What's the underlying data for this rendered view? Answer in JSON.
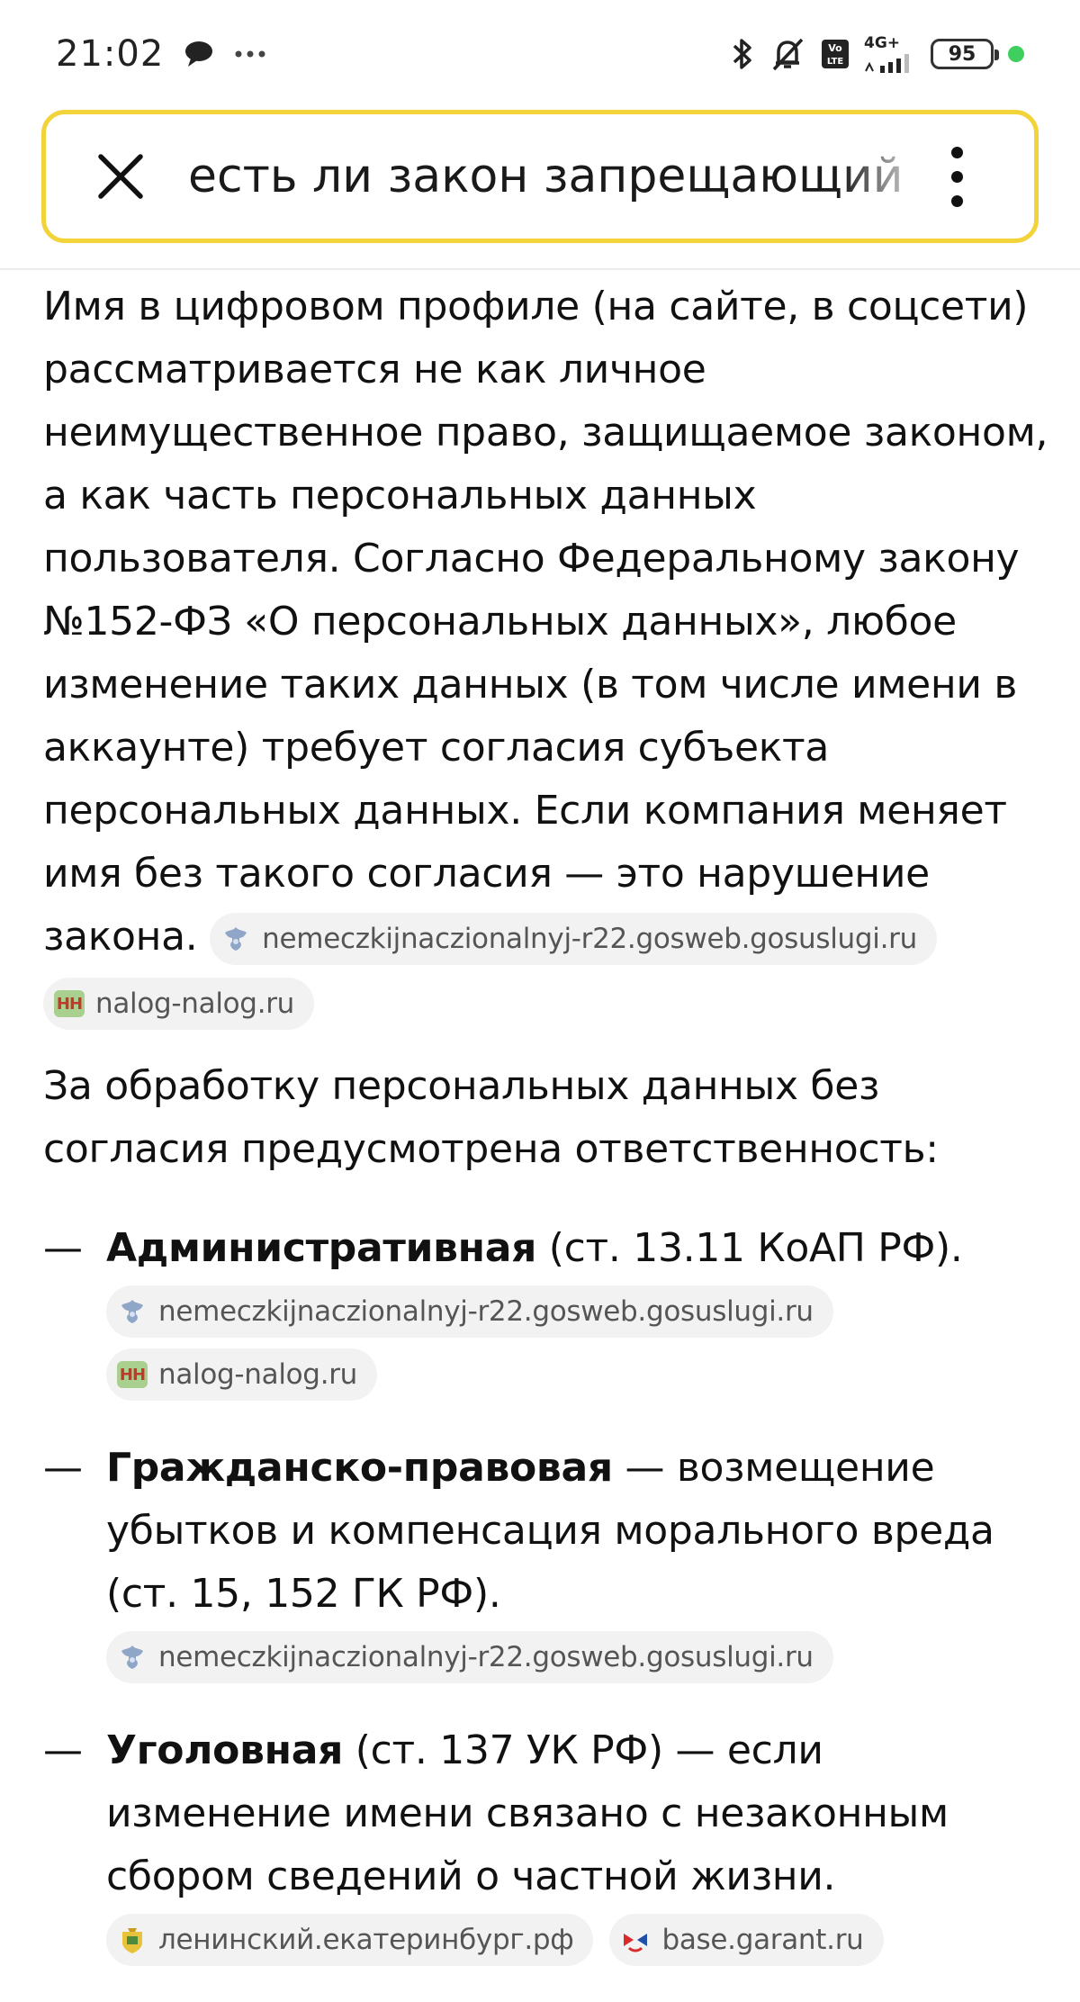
{
  "status_bar": {
    "time": "21:02",
    "network": "4G+",
    "battery": "95"
  },
  "search": {
    "query": "есть ли закон запрещающий"
  },
  "content": {
    "intro": "Имя в цифровом профиле (на сайте, в соцсети) рассматривается не как личное неимущественное право, защищаемое законом, а как часть персональных данных пользователя. Согласно Федеральному закону №152-ФЗ «О персональных данных», любое изменение таких данных (в том числе имени в аккаунте) требует согласия субъекта персональных данных. Если компания меняет имя без такого согласия — это нарушение закона.",
    "intro_sources": [
      "nemeczkijnaczionalnyj-r22.gosweb.gosuslugi.ru",
      "nalog-nalog.ru"
    ],
    "para2": "За обработку персональных данных без согласия предусмотрена ответственность:",
    "list": [
      {
        "bold": "Административная",
        "text": " (ст. 13.11 КоАП РФ).",
        "sources": [
          "nemeczkijnaczionalnyj-r22.gosweb.gosuslugi.ru",
          "nalog-nalog.ru"
        ]
      },
      {
        "bold": "Гражданско-правовая",
        "text": " — возмещение убытков и компенсация морального вреда (ст. 15, 152 ГК РФ).",
        "sources": [
          "nemeczkijnaczionalnyj-r22.gosweb.gosuslugi.ru"
        ]
      },
      {
        "bold": "Уголовная",
        "text": " (ст. 137 УК РФ) — если изменение имени связано с незаконным сбором сведений о частной жизни.",
        "sources": [
          "ленинский.екатеринбург.рф",
          "base.garant.ru"
        ]
      }
    ],
    "dash": "—",
    "favicon_nn": "НН"
  },
  "icons": {
    "gosuslugi": "eagle-emblem-icon",
    "nalog": "nn-favicon-icon",
    "ekb": "coat-of-arms-icon",
    "garant": "garant-logo-icon"
  },
  "colors": {
    "search_border": "#f2d33a",
    "chip_bg": "#f2f2f3",
    "chip_text": "#555555",
    "status_dot": "#3ecf5e"
  }
}
